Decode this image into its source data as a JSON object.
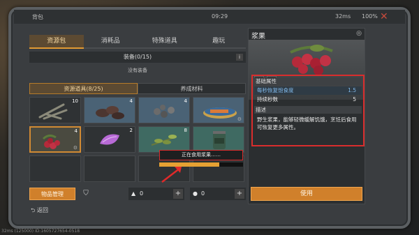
{
  "topbar": {
    "title": "背包",
    "time": "09:29",
    "ping": "32ms",
    "battery": "100%",
    "close_icon": "close-icon"
  },
  "tabs": [
    {
      "label": "资源包",
      "active": true
    },
    {
      "label": "消耗品",
      "active": false
    },
    {
      "label": "特殊道具",
      "active": false
    },
    {
      "label": "趣玩",
      "active": false
    }
  ],
  "equipment": {
    "header": "装备(0/15)",
    "info": "i",
    "empty_text": "没有装备"
  },
  "subtabs": [
    {
      "label": "资源道具(8/25)",
      "active": true
    },
    {
      "label": "养成材料",
      "active": false
    }
  ],
  "slots": [
    {
      "item": "branch-item",
      "count": "10",
      "style": "",
      "selected": false
    },
    {
      "item": "meat-item",
      "count": "4",
      "style": "blue",
      "selected": false
    },
    {
      "item": "stone-item",
      "count": "4",
      "style": "blue",
      "selected": false
    },
    {
      "item": "canned-fish-item",
      "count": "",
      "style": "blue",
      "selected": false
    },
    {
      "item": "berries-item",
      "count": "4",
      "style": "",
      "selected": true
    },
    {
      "item": "petal-item",
      "count": "2",
      "style": "",
      "selected": false
    },
    {
      "item": "herb-item",
      "count": "8",
      "style": "teal",
      "selected": false
    },
    {
      "item": "jar-item",
      "count": "",
      "style": "teal",
      "selected": false
    },
    {
      "item": "",
      "count": "",
      "style": "",
      "selected": false
    },
    {
      "item": "",
      "count": "",
      "style": "",
      "selected": false
    },
    {
      "item": "",
      "count": "",
      "style": "",
      "selected": false
    },
    {
      "item": "",
      "count": "",
      "style": "",
      "selected": false
    }
  ],
  "eating_status": {
    "text": "正在食用浆果……",
    "progress": 0.72
  },
  "bottom_bar": {
    "manage_label": "物品管理",
    "filter_icon": "filter-icon",
    "res1_value": "0",
    "res2_value": "0",
    "plus": "+"
  },
  "back_label": "返回",
  "detail": {
    "title": "浆果",
    "section_basic": "基础属性",
    "props": [
      {
        "key": "每秒恢复饱食度",
        "value": "1.5"
      },
      {
        "key": "持续秒数",
        "value": "5"
      }
    ],
    "section_desc": "描述",
    "description": "野生浆果，能够轻微缓解饥饿，烹饪后食用可恢复更多属性。",
    "use_label": "使用",
    "btn_trash": "🗑",
    "btn_more": "•••"
  },
  "status_bottom": "32ms (125000) ID:1605727654-0518",
  "colors": {
    "accent_orange": "#d0802b",
    "highlight_red": "#d92d2d",
    "tab_active_text": "#f3d7a2"
  }
}
